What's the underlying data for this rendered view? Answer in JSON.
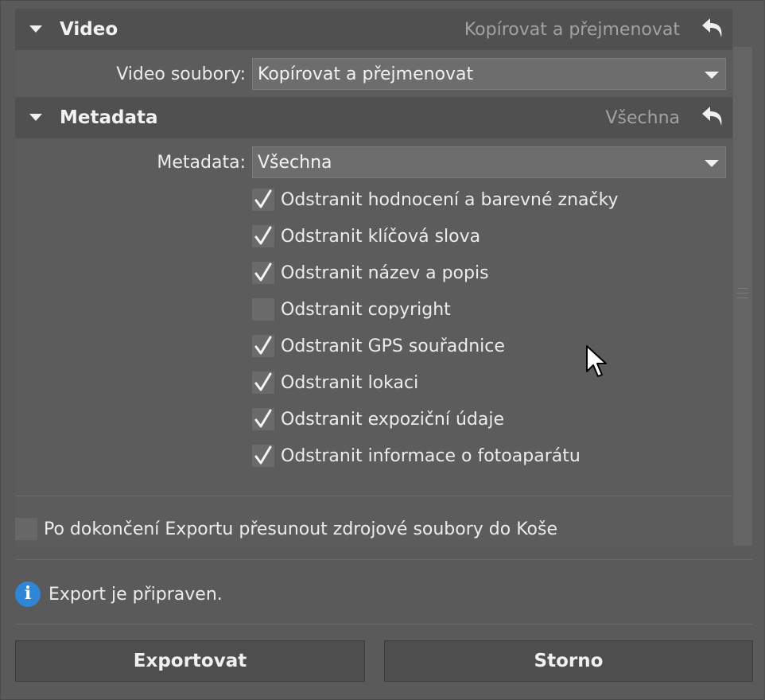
{
  "sections": {
    "video": {
      "title": "Video",
      "summary": "Kopírovat a přejmenovat",
      "field_label": "Video soubory:",
      "select_value": "Kopírovat a přejmenovat"
    },
    "metadata": {
      "title": "Metadata",
      "summary": "Všechna",
      "field_label": "Metadata:",
      "select_value": "Všechna",
      "options": [
        {
          "label": "Odstranit hodnocení a barevné značky",
          "checked": true
        },
        {
          "label": "Odstranit klíčová slova",
          "checked": true
        },
        {
          "label": "Odstranit název a popis",
          "checked": true
        },
        {
          "label": "Odstranit copyright",
          "checked": false
        },
        {
          "label": "Odstranit GPS souřadnice",
          "checked": true
        },
        {
          "label": "Odstranit lokaci",
          "checked": true
        },
        {
          "label": "Odstranit expoziční údaje",
          "checked": true
        },
        {
          "label": "Odstranit informace o fotoaparátu",
          "checked": true
        }
      ]
    }
  },
  "move_to_trash": {
    "label": "Po dokončení Exportu přesunout zdrojové soubory do Koše",
    "checked": false
  },
  "status": {
    "icon": "info-icon",
    "text": "Export je připraven."
  },
  "buttons": {
    "export": "Exportovat",
    "cancel": "Storno"
  },
  "colors": {
    "info": "#2f86d6",
    "header_bg": "#505050",
    "panel_bg": "#5c5c5c"
  }
}
